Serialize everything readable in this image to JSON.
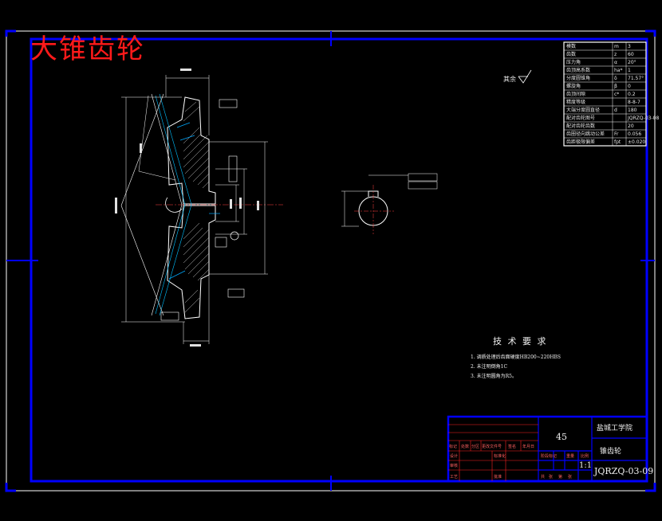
{
  "title": "大锥齿轮",
  "roughness_note": "其余",
  "tech_requirements": {
    "heading": "技 术 要 求",
    "items": [
      "1.  调质处理后齿面硬度HB200~220HBS",
      "2.  未注明倒角1C",
      "3.  未注明圆角为R5。"
    ]
  },
  "title_block": {
    "material": "45",
    "school": "盐城工学院",
    "part_name": "锥齿轮",
    "drawing_no": "JQRZQ-03-09",
    "scale": "1:1",
    "header_labels": [
      "标记",
      "处数",
      "分区",
      "更改文件号",
      "签名",
      "年月日"
    ],
    "row_labels": [
      "设计",
      "审核",
      "工艺"
    ],
    "std_label": "标准化",
    "approve_label": "批准",
    "stage_labels": [
      "阶段标记",
      "重量",
      "比例"
    ],
    "sheet_labels": [
      "共",
      "张",
      "第",
      "张"
    ]
  },
  "param_table": {
    "rows": [
      [
        "模数",
        "m",
        "3"
      ],
      [
        "齿数",
        "z",
        "60"
      ],
      [
        "压力角",
        "α",
        "20°"
      ],
      [
        "齿顶高系数",
        "ha*",
        "1"
      ],
      [
        "分度圆锥角",
        "δ",
        "71.57°"
      ],
      [
        "螺旋角",
        "β",
        "0"
      ],
      [
        "齿顶间隙",
        "c*",
        "0.2"
      ],
      [
        "精度等级",
        "",
        "8-8-7"
      ],
      [
        "大端分度圆直径",
        "d",
        "180"
      ],
      [
        "配对齿轮图号",
        "",
        "JQRZQ-03-08"
      ],
      [
        "配对齿轮齿数",
        "",
        "20"
      ],
      [
        "齿圈径向跳动公差",
        "Fr",
        "0.056"
      ],
      [
        "齿距极限偏差",
        "fpt",
        "±0.020"
      ]
    ]
  },
  "colors": {
    "frame": "#0000ff",
    "lines": "#ffffff",
    "dims": "#00c0ff",
    "hatch": "#d0d0d0",
    "title_red": "#ff1a1a"
  }
}
